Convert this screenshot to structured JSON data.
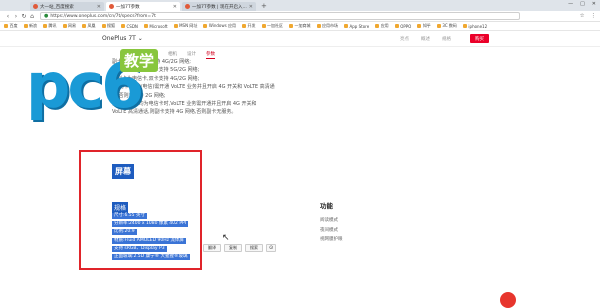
{
  "tabs": [
    {
      "label": "大一站_百度搜索",
      "active": false
    },
    {
      "label": "一加7T参数",
      "active": true
    },
    {
      "label": "一加7T参数 | 现在开启入...",
      "active": false
    }
  ],
  "browser": {
    "url": "https://www.oneplus.com/cn/7t/specs?from=7t",
    "new_tab": "+",
    "win_controls": [
      "—",
      "□",
      "✕"
    ],
    "nav_buttons": [
      "‹",
      "›",
      "↻",
      "⌂"
    ],
    "right_icons": [
      "☆",
      "⋮"
    ]
  },
  "bookmarks": [
    "百度",
    "新浪",
    "腾讯",
    "网易",
    "凤凰",
    "搜狐",
    "CSDN",
    "Microsoft",
    "MSN 网址",
    "Windows 应用",
    "开发",
    "一加社区",
    "一加商城",
    "应用市场",
    "App Store",
    "应用",
    "OPPO",
    "知乎",
    "3C 数码",
    "iphone12"
  ],
  "product": {
    "name": "OnePlus 7T",
    "name_arrow": "⌄",
    "tabs": [
      "亮点",
      "概述",
      "规格",
      "参数"
    ],
    "buy_label": "购买"
  },
  "subtabs": [
    "概述",
    "性能",
    "相机",
    "设计",
    "参数"
  ],
  "subtabs_active": 4,
  "logo": {
    "text": "pc6",
    "badge": "教学"
  },
  "network_notes": [
    "副卡:移动卡,双卡支持 4G/2G 网络;",
    "若副卡为联通卡,双卡支持 5G/2G 网络;",
    "若副卡为电信卡,双卡支持 4G/2G 网络;",
    "注:副卡(移动/电信)需开通 VoLTE 业务并且开启 4G 开关和 VoLTE 高清通",
    "话,否则只支持 2G 网络;",
    "注:若两张卡均为电信卡时,VoLTE 业务需开通并且开启 4G 开关和",
    "VoLTE 高清通话,则副卡支持 4G 网络,否则副卡无服务。"
  ],
  "screen": {
    "title": "屏幕",
    "spec_heading": "规格",
    "specs": [
      "尺寸:6.55 英寸",
      "分辨率:2400 x 1080 像素 402 PPI",
      "比例:20:9",
      "材质:Fluid AMOLED 90Hz 流体屏",
      "支持 sRGB、Display P3",
      "正面玻璃:2.5D 康宁® 大猩猩®玻璃"
    ]
  },
  "actions": [
    "翻译",
    "复制",
    "搜索",
    "⊙"
  ],
  "features": {
    "title": "功能",
    "items": [
      "阅读模式",
      "夜间模式",
      "视网膜护眼"
    ]
  },
  "cursor": "↖"
}
